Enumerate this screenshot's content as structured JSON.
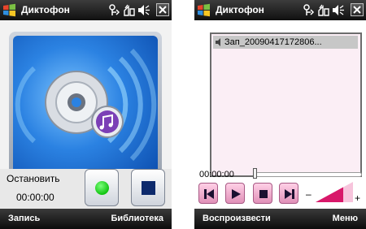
{
  "recorder_screen": {
    "title": "Диктофон",
    "status_label": "Остановить",
    "elapsed_time": "00:00:00",
    "softkeys": {
      "left": "Запись",
      "right": "Библиотека"
    },
    "icons": [
      "windows-start-icon",
      "connectivity-icon",
      "phone-signal-icon",
      "volume-icon",
      "close-icon",
      "media-player-art",
      "record-icon",
      "stop-icon"
    ]
  },
  "library_screen": {
    "title": "Диктофон",
    "recordings": [
      {
        "name": "Зап_20090417172806...",
        "selected": true
      }
    ],
    "position_time": "00:00:00",
    "seek_position": 0,
    "volume_minus": "–",
    "volume_plus": "+",
    "softkeys": {
      "left": "Воспроизвести",
      "right": "Меню"
    },
    "icons": [
      "previous-track-icon",
      "play-icon",
      "stop-icon",
      "next-track-icon",
      "volume-level-icon"
    ]
  },
  "colors": {
    "title_bar": "#1c1c1c",
    "accent_blue": "#2b82e2",
    "record_green": "#11c411",
    "stop_navy": "#0d2a6c",
    "list_pink": "#fbeef5",
    "button_pink": "#f0a8cc",
    "volume_magenta": "#d8186a"
  }
}
